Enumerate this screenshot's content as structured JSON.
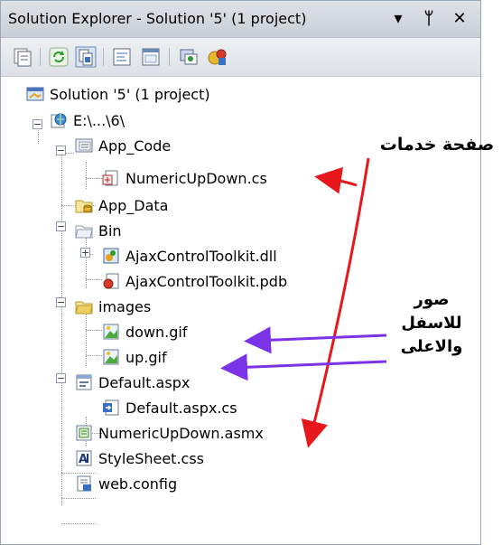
{
  "window": {
    "title": "Solution Explorer - Solution '5' (1 project)",
    "dropdown_glyph": "▾",
    "pin_glyph": "ᛘ",
    "close_glyph": "✕"
  },
  "toolbar": {
    "buttons": [
      "properties-icon",
      "refresh-icon",
      "show-all-files-icon",
      "view-code-icon",
      "view-designer-icon",
      "copy-website-icon",
      "asp-net-config-icon"
    ]
  },
  "tree": {
    "solution": "Solution '5' (1 project)",
    "project": "E:\\...\\6\\",
    "app_code": "App_Code",
    "numeric_cs": "NumericUpDown.cs",
    "app_data": "App_Data",
    "bin": "Bin",
    "ajax_dll": "AjaxControlToolkit.dll",
    "ajax_pdb": "AjaxControlToolkit.pdb",
    "images": "images",
    "down_gif": "down.gif",
    "up_gif": "up.gif",
    "default_aspx": "Default.aspx",
    "default_cs": "Default.aspx.cs",
    "numeric_asmx": "NumericUpDown.asmx",
    "stylesheet": "StyleSheet.css",
    "webconfig": "web.config",
    "expand_plus": "+",
    "collapse_minus": "−"
  },
  "annotations": {
    "service_page": "صفحة خدمات",
    "images_line1": "صور",
    "images_line2": "للاسفل",
    "images_line3": "والاعلى"
  },
  "colors": {
    "red_arrow": "#e8171b",
    "purple_arrow": "#7a33e6"
  }
}
